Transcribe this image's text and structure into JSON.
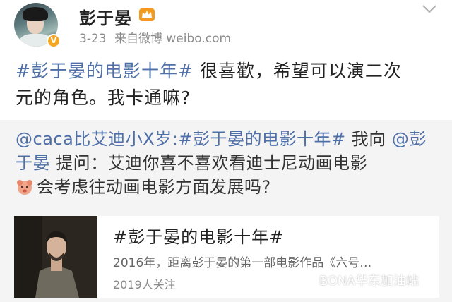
{
  "post": {
    "username": "彭于晏",
    "date": "3-23",
    "source": "来自微博 weibo.com",
    "topic": "#彭于晏的电影十年#",
    "text_line1": " 很喜歡，希望可以演二次",
    "text_line2": "元的角色。我卡通嘛?"
  },
  "repost": {
    "author": "@caca比艾迪小X岁",
    "colon": ":",
    "topic": "#彭于晏的电影十年#",
    "text_a": " 我向 ",
    "mention": "@彭于晏",
    "text_b": " 提问：艾迪你喜不喜欢看迪士尼动画电影",
    "text_c": "会考虑往动画电影方面发展吗?"
  },
  "card": {
    "title": "#彭于晏的电影十年#",
    "description": "2016年，距离彭于晏的第一部电影作品《六号…",
    "followers": "2019人关注"
  },
  "watermark": {
    "text": "BONA华东加油站"
  },
  "colors": {
    "link": "#4e6fa8",
    "repost_bg": "#f4f4f4",
    "meta": "#8a8a8a",
    "verified": "#f5a623"
  },
  "icons": [
    "verified-icon",
    "vip-crown-icon",
    "chevron-down-icon",
    "emoji-icon",
    "wechat-icon"
  ]
}
